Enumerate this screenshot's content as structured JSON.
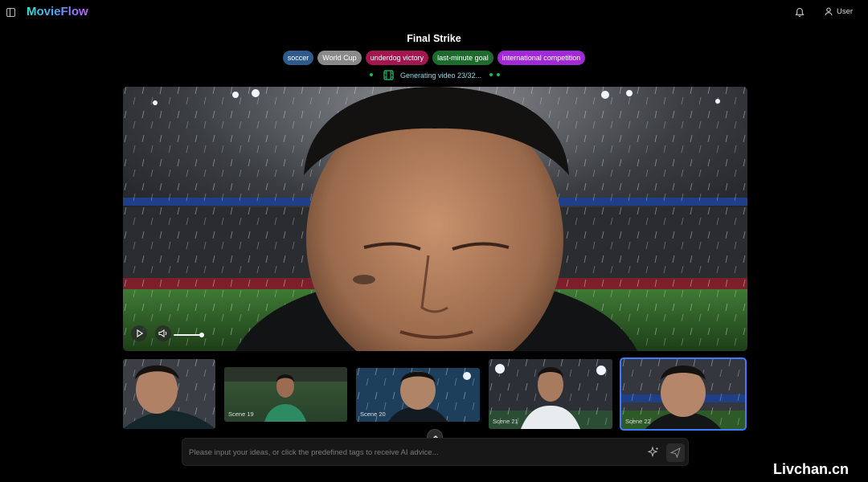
{
  "app": {
    "brand": "MovieFlow",
    "user_label": "User"
  },
  "project": {
    "title": "Final Strike",
    "tags": [
      {
        "label": "soccer",
        "color": "#2f5a8c"
      },
      {
        "label": "World Cup",
        "color": "#8a8a8a"
      },
      {
        "label": "underdog victory",
        "color": "#a3174f"
      },
      {
        "label": "last-minute goal",
        "color": "#1e6b2e"
      },
      {
        "label": "international competition",
        "color": "#a12ad6"
      }
    ],
    "status": {
      "text": "Generating video 23/32...",
      "current": 23,
      "total": 32
    }
  },
  "player": {
    "image_alt": "Close-up of a soaked soccer player with eyes closed in rain at a stadium",
    "progress": 0.15,
    "play_icon": "play-icon",
    "volume_icon": "volume-icon"
  },
  "scenes": [
    {
      "label": "",
      "active": false
    },
    {
      "label": "Scene 19",
      "active": false
    },
    {
      "label": "Scene 20",
      "active": false
    },
    {
      "label": "Scene 21",
      "active": false
    },
    {
      "label": "Scene 22",
      "active": true
    }
  ],
  "chat": {
    "placeholder": "Please input your ideas, or click the predefined tags to receive AI advice..."
  },
  "colors": {
    "accent": "#3d7cff",
    "status_dot": "#1db954"
  },
  "watermark": "Livchan.cn"
}
